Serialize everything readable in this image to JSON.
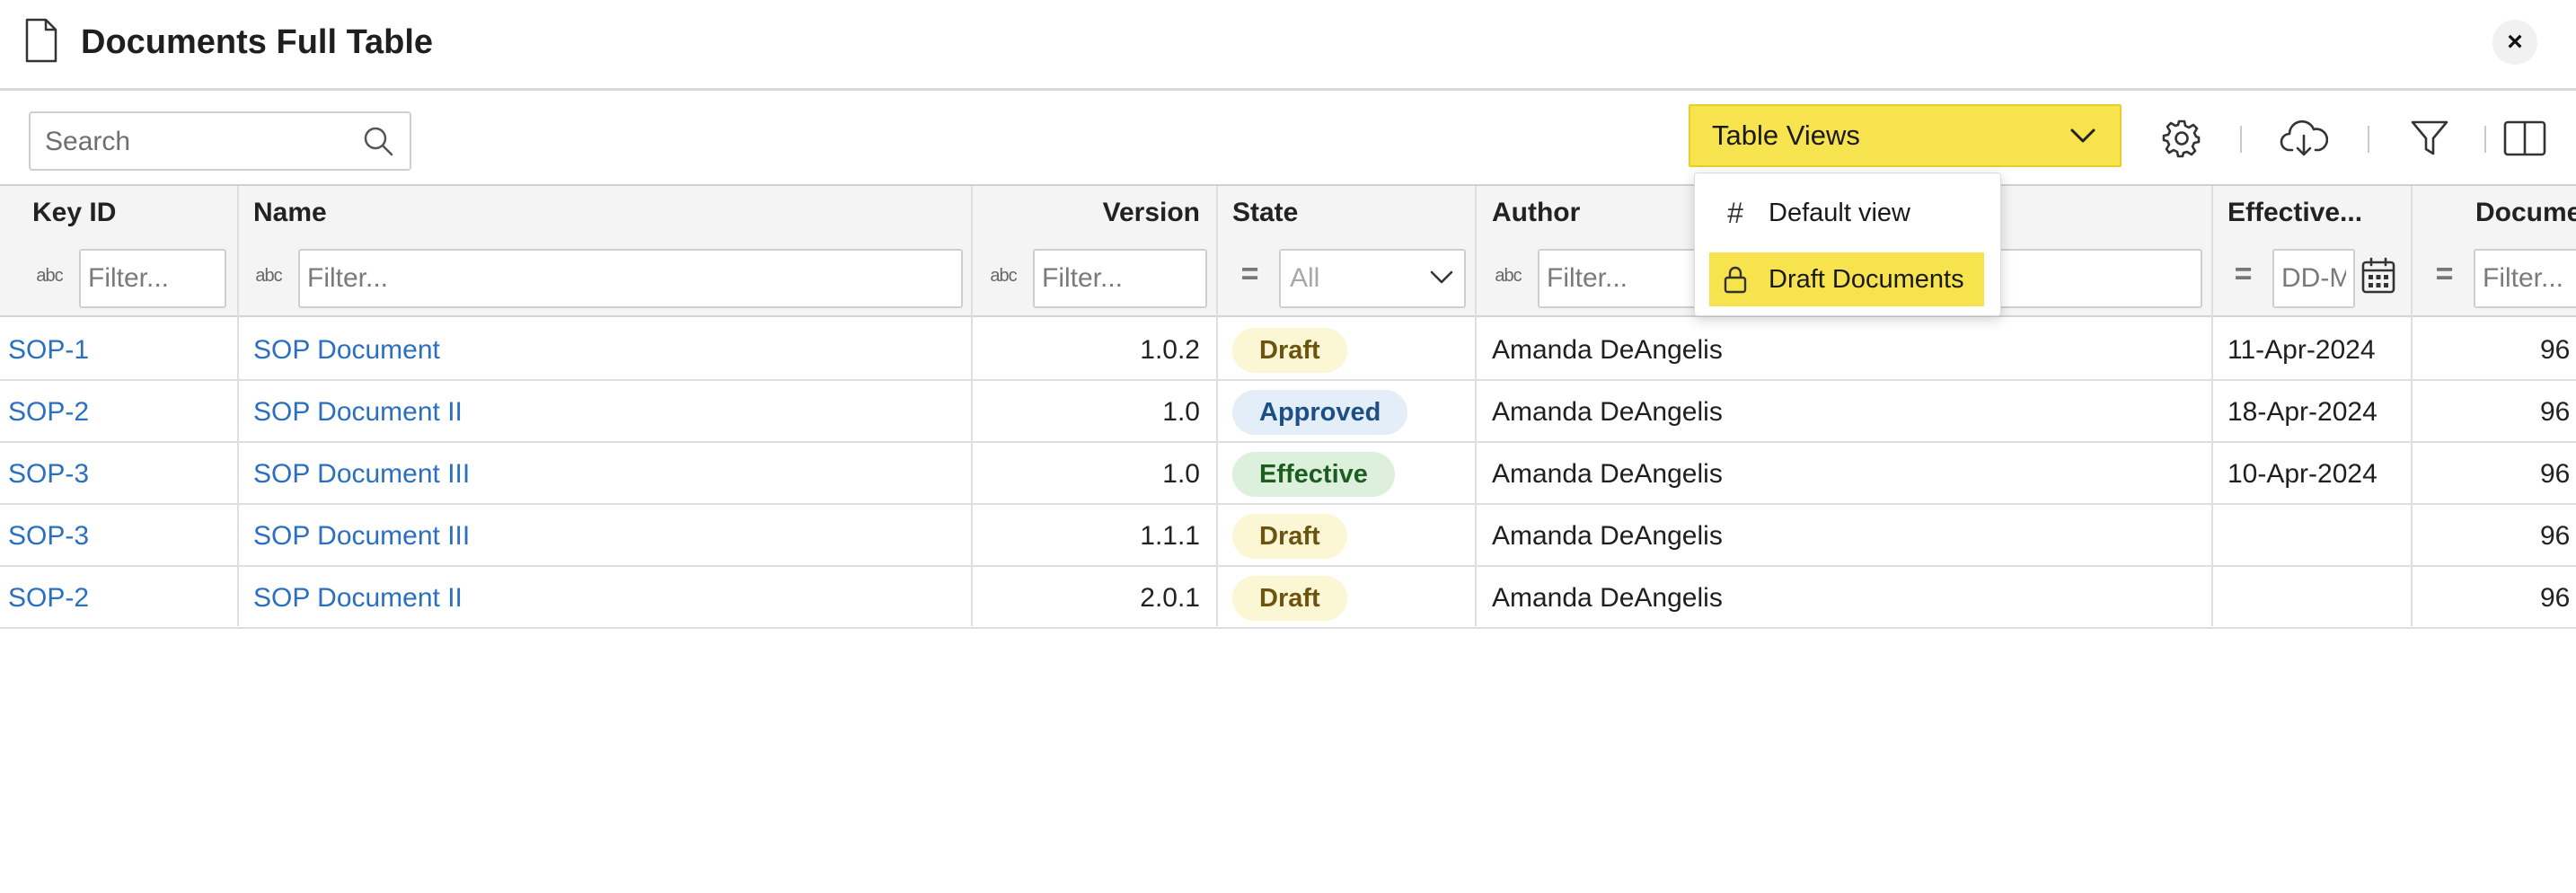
{
  "header": {
    "title": "Documents Full Table",
    "close_label": "×"
  },
  "toolbar": {
    "search_placeholder": "Search",
    "table_views_label": "Table Views",
    "highlight_color": "#f7e34d"
  },
  "views_menu": {
    "items": [
      {
        "label": "Default view",
        "icon": "hash-icon",
        "selected": false
      },
      {
        "label": "Draft Documents",
        "icon": "lock-icon",
        "selected": true
      }
    ]
  },
  "table": {
    "columns": [
      "Key ID",
      "Name",
      "Version",
      "State",
      "Author",
      "Effective...",
      "Docume"
    ],
    "filters": {
      "text_placeholder": "Filter...",
      "state_value": "All",
      "date_placeholder": "DD-M",
      "type_text_glyph": "abc",
      "type_eq_glyph": "="
    },
    "rows": [
      {
        "key": "SOP-1",
        "name": "SOP Document",
        "version": "1.0.2",
        "state": "Draft",
        "author": "Amanda DeAngelis",
        "effective": "11-Apr-2024",
        "doc": "96"
      },
      {
        "key": "SOP-2",
        "name": "SOP Document II",
        "version": "1.0",
        "state": "Approved",
        "author": "Amanda DeAngelis",
        "effective": "18-Apr-2024",
        "doc": "96"
      },
      {
        "key": "SOP-3",
        "name": "SOP Document III",
        "version": "1.0",
        "state": "Effective",
        "author": "Amanda DeAngelis",
        "effective": "10-Apr-2024",
        "doc": "96"
      },
      {
        "key": "SOP-3",
        "name": "SOP Document III",
        "version": "1.1.1",
        "state": "Draft",
        "author": "Amanda DeAngelis",
        "effective": "",
        "doc": "96"
      },
      {
        "key": "SOP-2",
        "name": "SOP Document II",
        "version": "2.0.1",
        "state": "Draft",
        "author": "Amanda DeAngelis",
        "effective": "",
        "doc": "96"
      }
    ]
  }
}
